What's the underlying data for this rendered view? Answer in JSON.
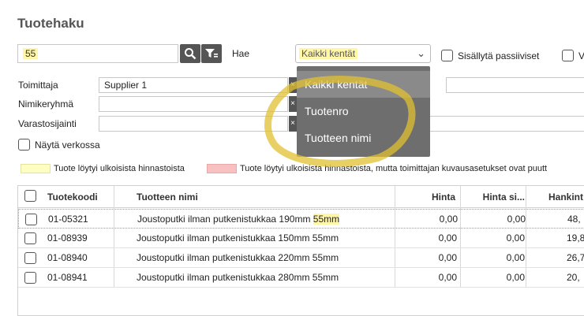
{
  "page": {
    "title": "Tuotehaku"
  },
  "search": {
    "value": "55",
    "hae_label": "Hae"
  },
  "scope_select": {
    "selected": "Kaikki kentät",
    "options": [
      "Kaikki kentät",
      "Tuotenro",
      "Tuotteen nimi"
    ]
  },
  "options": {
    "include_passive": "Sisällytä passiiviset"
  },
  "filters": {
    "supplier_label": "Toimittaja",
    "supplier_value": "Supplier 1",
    "group_label": "Nimikeryhmä",
    "location_label": "Varastosijainti",
    "show_online": "Näytä verkossa"
  },
  "legend": {
    "yellow": "Tuote löytyi ulkoisista hinnastoista",
    "red": "Tuote löytyi ulkoisista hinnastoista, mutta toimittajan kuvausasetukset ovat puutt"
  },
  "table": {
    "headers": {
      "code": "Tuotekoodi",
      "name": "Tuotteen nimi",
      "price": "Hinta",
      "price_si": "Hinta si...",
      "hankint": "Hankint"
    },
    "rows": [
      {
        "code": "01-05321",
        "name": "Joustoputki ilman putkenistukkaa 190mm",
        "name_hl": "55mm",
        "price": "0,00",
        "price_si": "0,00",
        "hankint": "48,"
      },
      {
        "code": "01-08939",
        "name": "Joustoputki ilman putkenistukkaa 150mm 55mm",
        "price": "0,00",
        "price_si": "0,00",
        "hankint": "19,8"
      },
      {
        "code": "01-08940",
        "name": "Joustoputki ilman putkenistukkaa 220mm 55mm",
        "price": "0,00",
        "price_si": "0,00",
        "hankint": "26,7"
      },
      {
        "code": "01-08941",
        "name": "Joustoputki ilman putkenistukkaa 280mm 55mm",
        "price": "0,00",
        "price_si": "0,00",
        "hankint": "20,"
      }
    ]
  },
  "colors": {
    "accent": "#555555",
    "highlight": "#fff6a8",
    "ring": "#e0c030"
  }
}
